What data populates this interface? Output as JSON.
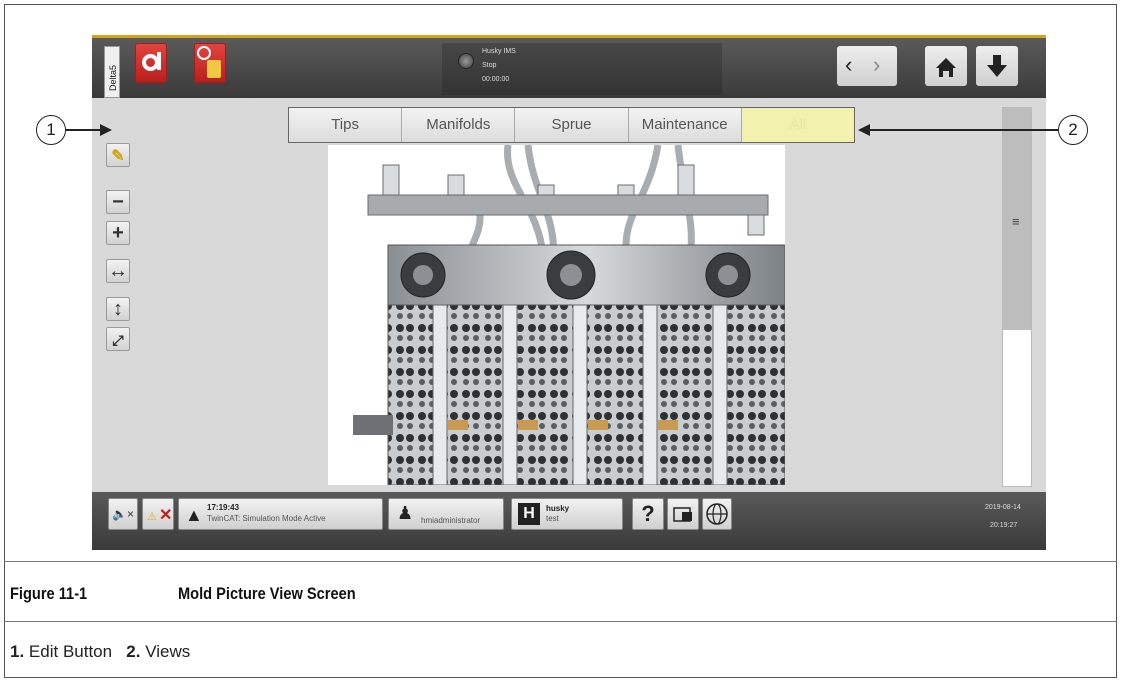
{
  "tab_vertical": "Delta5",
  "header": {
    "status_line1": "Husky IMS",
    "status_line2": "Stop",
    "status_line3": "00:00:00"
  },
  "tools": [
    {
      "name": "edit-button",
      "icon": "edit-icon",
      "glyph": "✎"
    },
    {
      "name": "zoom-out-button",
      "icon": "minus-icon",
      "glyph": "−"
    },
    {
      "name": "zoom-in-button",
      "icon": "plus-icon",
      "glyph": "+"
    },
    {
      "name": "fit-width-button",
      "icon": "horizontal-arrows-icon",
      "glyph": "↔"
    },
    {
      "name": "fit-height-button",
      "icon": "vertical-arrows-icon",
      "glyph": "↕"
    },
    {
      "name": "actual-size-button",
      "icon": "expand-100-icon",
      "glyph": "⤢"
    }
  ],
  "filters": [
    "Tips",
    "Manifolds",
    "Sprue",
    "Maintenance",
    "All"
  ],
  "active_filter": "All",
  "bottombar": {
    "alarm_time": "17:19:43",
    "alarm_text": "TwinCAT: Simulation Mode Active",
    "user": "hmiadministrator",
    "mold_line1": "husky",
    "mold_line2": "test",
    "help": "?",
    "date": "2019-08-14",
    "time": "20:19:27"
  },
  "callouts": {
    "one": "1",
    "two": "2"
  },
  "caption": {
    "figure_number": "Figure 11-1",
    "figure_title": "Mold Picture View Screen",
    "item1_num": "1.",
    "item1_text": "Edit Button",
    "item2_num": "2.",
    "item2_text": "Views"
  },
  "colors": {
    "accent_red": "#c41d1a",
    "active_tab": "#f2f2ae",
    "topbar_trim": "#d4a418"
  }
}
